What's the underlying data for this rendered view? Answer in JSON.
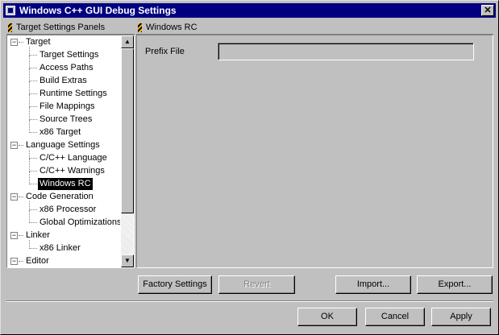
{
  "window": {
    "title": "Windows C++ GUI Debug Settings",
    "close_glyph": "✕"
  },
  "left_panel": {
    "title": "Target Settings Panels"
  },
  "right_panel": {
    "title": "Windows RC",
    "prefix_file_label": "Prefix File",
    "prefix_file_value": ""
  },
  "tree": {
    "expander_glyph": "−",
    "items": [
      {
        "label": "Target",
        "level": 0
      },
      {
        "label": "Target Settings",
        "level": 1
      },
      {
        "label": "Access Paths",
        "level": 1
      },
      {
        "label": "Build Extras",
        "level": 1
      },
      {
        "label": "Runtime Settings",
        "level": 1
      },
      {
        "label": "File Mappings",
        "level": 1
      },
      {
        "label": "Source Trees",
        "level": 1
      },
      {
        "label": "x86 Target",
        "level": 1
      },
      {
        "label": "Language Settings",
        "level": 0
      },
      {
        "label": "C/C++ Language",
        "level": 1
      },
      {
        "label": "C/C++ Warnings",
        "level": 1
      },
      {
        "label": "Windows RC",
        "level": 1,
        "selected": true
      },
      {
        "label": "Code Generation",
        "level": 0
      },
      {
        "label": "x86 Processor",
        "level": 1
      },
      {
        "label": "Global Optimizations",
        "level": 1
      },
      {
        "label": "Linker",
        "level": 0
      },
      {
        "label": "x86 Linker",
        "level": 1
      },
      {
        "label": "Editor",
        "level": 0
      }
    ]
  },
  "scrollbar": {
    "up_glyph": "▲",
    "down_glyph": "▼"
  },
  "buttons": {
    "factory_settings": "Factory Settings",
    "revert": "Revert",
    "import": "Import...",
    "export": "Export...",
    "ok": "OK",
    "cancel": "Cancel",
    "apply": "Apply"
  }
}
